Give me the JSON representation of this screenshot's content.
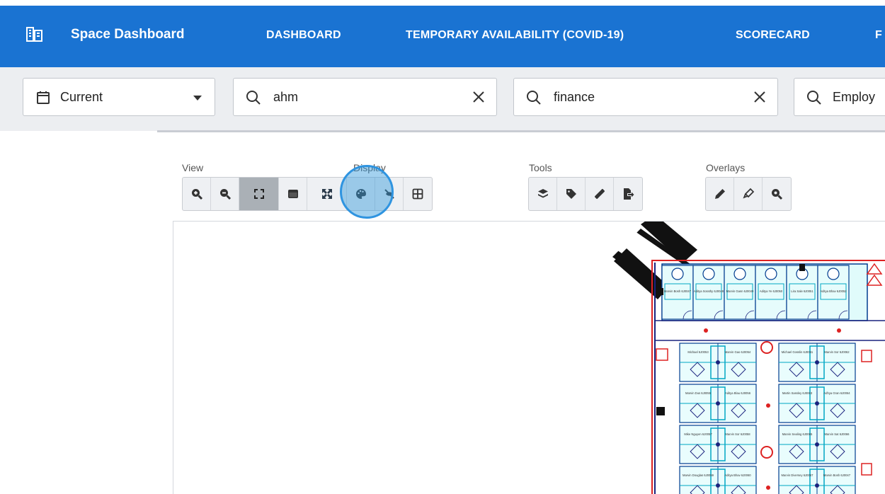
{
  "appbar": {
    "brand": "Space Dashboard",
    "brand_icon": "building-icon",
    "nav": [
      "DASHBOARD",
      "TEMPORARY AVAILABILITY (COVID-19)",
      "SCORECARD",
      "F"
    ]
  },
  "filters": {
    "period": {
      "value": "Current",
      "icon": "calendar-icon"
    },
    "search1": {
      "value": "ahm"
    },
    "search2": {
      "value": "finance"
    },
    "search3": {
      "value": "Employ"
    }
  },
  "toolbar": {
    "groups": {
      "view": "View",
      "display": "Display",
      "tools": "Tools",
      "overlays": "Overlays"
    },
    "view_buttons": [
      "zoom-in-icon",
      "zoom-out-icon",
      "fit-extents-icon",
      "window-icon"
    ],
    "display_buttons": [
      "expand-arrows-icon",
      "palette-icon",
      "eye-slash-icon",
      "grid-icon"
    ],
    "tools_buttons": [
      "layers-icon",
      "tag-icon",
      "ruler-icon",
      "file-export-icon"
    ],
    "overlay_buttons": [
      "pen-icon",
      "highlighter-icon",
      "search-zoom-icon"
    ],
    "active_button": "fit-extents-icon",
    "accent": "#1a73d2"
  },
  "floorplan": {
    "labels": [
      "Marvin Bosh 6J0047",
      "Aditya Sorathy 6J0048",
      "Marvin Gasn 6J0049",
      "Aditya Ye 6J0050",
      "Lira Sale 6J0051",
      "Aditya Bhav 6J0052",
      "Michael 6J0053",
      "Marvin Gao 6J0054",
      "Marvin Dus 6J0055",
      "Aditya Blau 6J0056",
      "Mike Nguyen 6J0057",
      "Marvin Sor 6J0058",
      "Marvin Douglas 6J0059",
      "Aditya Bhav 6J0060",
      "Michael Gosslin 6J0061",
      "Marvin Sor 6J0062",
      "Martin Sassley 6J0063",
      "Adhya Gran 6J0064",
      "Marvin Sealing 6J0065",
      "Marvin Sat 6J0066",
      "Marvin Diversey 6J0067"
    ]
  }
}
